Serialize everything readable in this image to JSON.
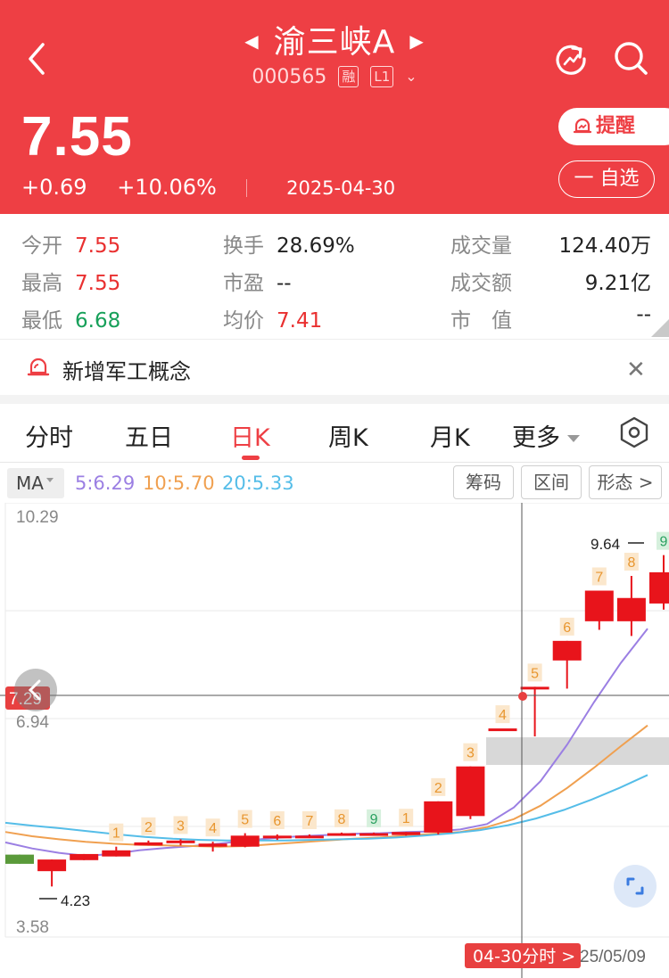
{
  "header": {
    "stock_name": "渝三峡A",
    "stock_code": "000565",
    "tag_margin": "融",
    "tag_level": "L1",
    "price": "7.55",
    "change": "+0.69",
    "change_pct": "+10.06%",
    "date": "2025-04-30",
    "remind_label": "提醒",
    "watchlist_label": "一 自选",
    "header_color": "#ee3f44",
    "icons": [
      "back-arrow-icon",
      "prev-stock-icon",
      "next-stock-icon",
      "refresh-icon",
      "search-icon"
    ]
  },
  "stats": {
    "open": {
      "label": "今开",
      "value": "7.55"
    },
    "high": {
      "label": "最高",
      "value": "7.55"
    },
    "low": {
      "label": "最低",
      "value": "6.68"
    },
    "turnover_rate": {
      "label": "换手",
      "value": "28.69%"
    },
    "pe": {
      "label": "市盈",
      "value": "--"
    },
    "avg_price": {
      "label": "均价",
      "value": "7.41"
    },
    "volume": {
      "label": "成交量",
      "value": "124.40万"
    },
    "amount": {
      "label": "成交额",
      "value": "9.21亿"
    },
    "market_cap": {
      "label": "市　值",
      "value": "--"
    }
  },
  "notice": {
    "text": "新增军工概念"
  },
  "tabs": [
    {
      "label": "分时",
      "active": false
    },
    {
      "label": "五日",
      "active": false
    },
    {
      "label": "日K",
      "active": true
    },
    {
      "label": "周K",
      "active": false
    },
    {
      "label": "月K",
      "active": false
    },
    {
      "label": "更多",
      "active": false
    }
  ],
  "ma": {
    "selector": "MA",
    "ma5": "5:6.29",
    "ma10": "10:5.70",
    "ma20": "20:5.33",
    "colors": {
      "ma5": "#9b7fe3",
      "ma10": "#f0a050",
      "ma20": "#55bde8"
    },
    "buttons": [
      "筹码",
      "区间",
      "形态 >"
    ]
  },
  "chart_data": {
    "type": "candlestick",
    "y_labels": {
      "top": "10.29",
      "cursor": "7.29",
      "upper": "6.94",
      "bottom": "3.58"
    },
    "annotations": {
      "max": "9.64",
      "min": "4.23"
    },
    "cursor_label": "04-30分时 >",
    "x_end_label": "25/05/09",
    "ylim": [
      3.58,
      10.29
    ],
    "candles": [
      {
        "open": 4.75,
        "close": 4.6,
        "high": 4.75,
        "low": 4.6,
        "seq": ""
      },
      {
        "open": 4.67,
        "close": 4.48,
        "high": 4.67,
        "low": 4.23,
        "seq": ""
      },
      {
        "open": 4.66,
        "close": 4.76,
        "high": 4.76,
        "low": 4.66,
        "seq": ""
      },
      {
        "open": 4.72,
        "close": 4.82,
        "high": 4.88,
        "low": 4.72,
        "seq": "1"
      },
      {
        "open": 4.9,
        "close": 4.95,
        "high": 4.98,
        "low": 4.9,
        "seq": "2"
      },
      {
        "open": 4.95,
        "close": 4.98,
        "high": 5.0,
        "low": 4.9,
        "seq": "3"
      },
      {
        "open": 4.93,
        "close": 4.88,
        "high": 4.96,
        "low": 4.8,
        "seq": "4"
      },
      {
        "open": 4.88,
        "close": 5.06,
        "high": 5.1,
        "low": 4.87,
        "seq": "5"
      },
      {
        "open": 5.02,
        "close": 5.06,
        "high": 5.08,
        "low": 4.99,
        "seq": "6"
      },
      {
        "open": 5.04,
        "close": 5.06,
        "high": 5.08,
        "low": 5.02,
        "seq": "7"
      },
      {
        "open": 5.07,
        "close": 5.1,
        "high": 5.11,
        "low": 5.06,
        "seq": "8"
      },
      {
        "open": 5.08,
        "close": 5.1,
        "high": 5.11,
        "low": 5.07,
        "seq": "9"
      },
      {
        "open": 5.07,
        "close": 5.12,
        "high": 5.12,
        "low": 5.06,
        "seq": "1"
      },
      {
        "open": 5.11,
        "close": 5.62,
        "high": 5.62,
        "low": 5.08,
        "seq": "2"
      },
      {
        "open": 5.38,
        "close": 6.19,
        "high": 6.19,
        "low": 5.33,
        "seq": "3"
      },
      {
        "open": 6.81,
        "close": 6.81,
        "high": 6.81,
        "low": 6.81,
        "seq": "4"
      },
      {
        "open": 7.49,
        "close": 7.49,
        "high": 7.49,
        "low": 6.68,
        "seq": "5"
      },
      {
        "open": 7.92,
        "close": 8.24,
        "high": 8.24,
        "low": 7.46,
        "seq": "6"
      },
      {
        "open": 8.56,
        "close": 9.06,
        "high": 9.06,
        "low": 8.42,
        "seq": "7"
      },
      {
        "open": 8.56,
        "close": 8.94,
        "high": 9.3,
        "low": 8.32,
        "seq": "8"
      },
      {
        "open": 8.85,
        "close": 9.36,
        "high": 9.64,
        "low": 8.75,
        "seq": "9"
      }
    ],
    "series": [
      {
        "name": "MA5",
        "color": "#9b7fe3",
        "values": [
          4.95,
          4.85,
          4.78,
          4.73,
          4.76,
          4.82,
          4.86,
          4.89,
          4.93,
          4.98,
          5.02,
          5.05,
          5.07,
          5.09,
          5.1,
          5.12,
          5.13,
          5.16,
          5.25,
          5.52,
          5.95,
          6.55,
          7.24,
          7.88,
          8.44
        ]
      },
      {
        "name": "MA10",
        "color": "#f0a050",
        "values": [
          5.12,
          5.05,
          5.0,
          4.96,
          4.93,
          4.91,
          4.9,
          4.89,
          4.88,
          4.89,
          4.92,
          4.95,
          4.98,
          5.01,
          5.03,
          5.06,
          5.09,
          5.12,
          5.2,
          5.33,
          5.55,
          5.84,
          6.17,
          6.52,
          6.86
        ]
      },
      {
        "name": "MA20",
        "color": "#55bde8",
        "values": [
          5.27,
          5.22,
          5.18,
          5.13,
          5.08,
          5.04,
          5.01,
          4.99,
          4.98,
          4.98,
          4.98,
          4.99,
          5.0,
          5.01,
          5.03,
          5.06,
          5.1,
          5.15,
          5.23,
          5.34,
          5.48,
          5.65,
          5.84,
          6.05
        ]
      }
    ]
  }
}
